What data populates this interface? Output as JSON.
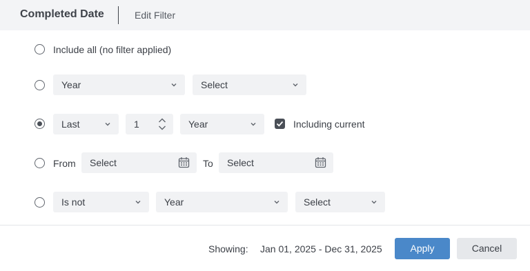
{
  "header": {
    "title": "Completed Date",
    "edit_filter_label": "Edit Filter"
  },
  "options": {
    "include_all": {
      "label": "Include all (no filter applied)",
      "selected": false
    },
    "year_row": {
      "selected": false,
      "period": "Year",
      "value": "Select"
    },
    "last_row": {
      "selected": true,
      "mode": "Last",
      "count": "1",
      "unit": "Year",
      "including_current_label": "Including current",
      "including_current_checked": true
    },
    "range_row": {
      "selected": false,
      "from_label": "From",
      "from_value": "Select",
      "to_label": "To",
      "to_value": "Select"
    },
    "is_not_row": {
      "selected": false,
      "operator": "Is not",
      "period": "Year",
      "value": "Select"
    }
  },
  "footer": {
    "showing_label": "Showing:",
    "showing_value": "Jan 01, 2025 - Dec 31, 2025",
    "apply_label": "Apply",
    "cancel_label": "Cancel"
  },
  "colors": {
    "accent": "#4a88c9",
    "header_bg": "#f3f4f6",
    "field_bg": "#f1f2f4"
  }
}
